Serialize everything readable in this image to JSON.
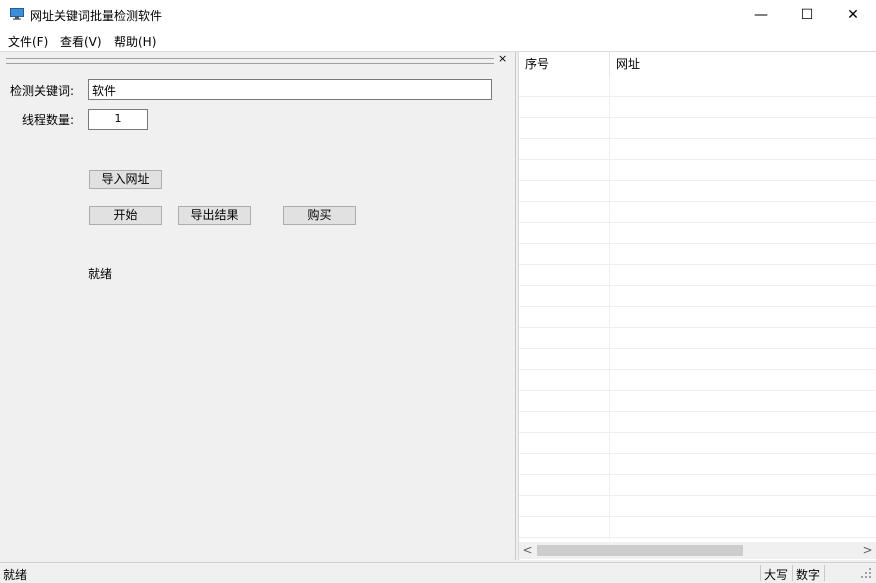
{
  "window": {
    "title": "网址关键词批量检测软件",
    "minimize": "—",
    "maximize": "☐",
    "close": "✕"
  },
  "menu": {
    "file": "文件(F)",
    "view": "查看(V)",
    "help": "帮助(H)"
  },
  "panel": {
    "close_glyph": "×",
    "keyword_label": "检测关键词:",
    "keyword_value": "软件",
    "threads_label": "线程数量:",
    "threads_value": "1",
    "import_button": "导入网址",
    "start_button": "开始",
    "export_button": "导出结果",
    "buy_button": "购买",
    "status": "就绪"
  },
  "list": {
    "columns": [
      "序号",
      "网址"
    ],
    "scroll_left": "<",
    "scroll_right": ">"
  },
  "statusbar": {
    "text": "就绪",
    "caps": "大写",
    "num": "数字"
  }
}
